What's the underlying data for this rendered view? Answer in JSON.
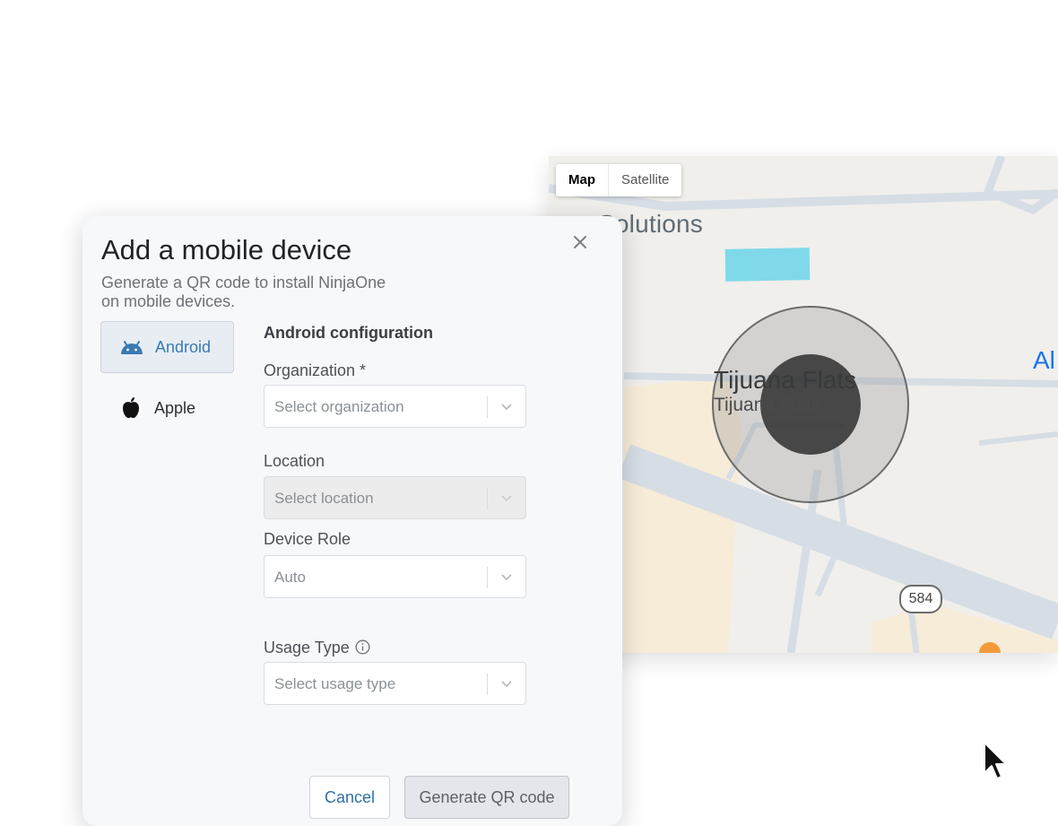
{
  "map": {
    "map_tab": "Map",
    "satellite_tab": "Satellite",
    "label_business": "Solutions",
    "label_place": "Tijuana Flats",
    "label_place_sub": "Tijuana Flats",
    "label_edge": "Al",
    "route_shield": "584"
  },
  "dialog": {
    "title": "Add a mobile device",
    "subtitle": "Generate a QR code to install NinjaOne on mobile devices.",
    "tabs": [
      {
        "label": "Android",
        "icon": "android-icon",
        "selected": true
      },
      {
        "label": "Apple",
        "icon": "apple-icon",
        "selected": false
      }
    ],
    "config_title": "Android configuration",
    "fields": {
      "organization": {
        "label": "Organization *",
        "placeholder": "Select organization"
      },
      "location": {
        "label": "Location",
        "placeholder": "Select location"
      },
      "device_role": {
        "label": "Device Role",
        "value": "Auto"
      },
      "usage_type": {
        "label": "Usage Type",
        "placeholder": "Select usage type"
      }
    },
    "cancel_label": "Cancel",
    "generate_label": "Generate QR code"
  },
  "colors": {
    "accent": "#3a7ab2",
    "dialog_bg": "#f7f8fa",
    "selected_tab_bg": "#e8edf3"
  }
}
